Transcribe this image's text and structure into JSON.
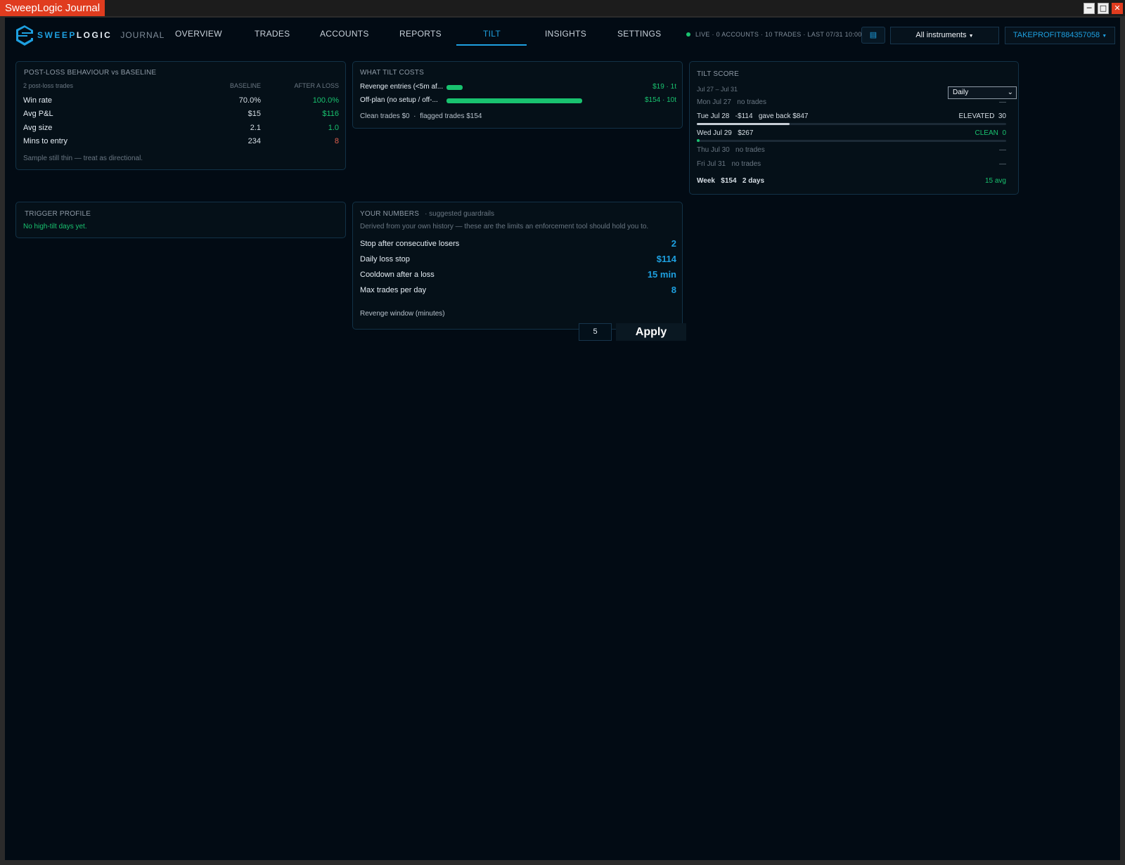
{
  "window": {
    "title": "SweepLogic Journal",
    "buttons": [
      "minimize",
      "maximize",
      "close"
    ]
  },
  "brand": {
    "name_part1": "SWEEP",
    "name_part2": "LOGIC",
    "sub": "JOURNAL",
    "accent": "#1ea0e0"
  },
  "nav": {
    "tabs": [
      {
        "label": "OVERVIEW"
      },
      {
        "label": "TRADES"
      },
      {
        "label": "ACCOUNTS"
      },
      {
        "label": "REPORTS"
      },
      {
        "label": "TILT"
      },
      {
        "label": "INSIGHTS"
      },
      {
        "label": "SETTINGS"
      }
    ],
    "active_tab": "TILT",
    "status": "LIVE · 0 ACCOUNTS · 10 TRADES · LAST 07/31 10:00",
    "instrument_filter": "All instruments",
    "account": "TAKEPROFIT884357058"
  },
  "post_loss": {
    "title": "POST-LOSS BEHAVIOUR vs BASELINE",
    "sample_note": "2 post-loss trades",
    "col_baseline": "BASELINE",
    "col_after": "AFTER A LOSS",
    "rows": [
      {
        "label": "Win rate",
        "baseline": "70.0%",
        "after": "100.0%"
      },
      {
        "label": "Avg P&L",
        "baseline": "$15",
        "after": "$116"
      },
      {
        "label": "Avg size",
        "baseline": "2.1",
        "after": "1.0"
      },
      {
        "label": "Mins to entry",
        "baseline": "234",
        "after": "8"
      }
    ],
    "footnote": "Sample still thin — treat as directional."
  },
  "tilt_costs": {
    "title": "WHAT TILT COSTS",
    "rows": [
      {
        "label": "Revenge entries (<5m af...",
        "amount": "$19",
        "count": "1t",
        "share": 0.12
      },
      {
        "label": "Off-plan (no setup / off-...",
        "amount": "$154",
        "count": "10t",
        "share": 1.0
      }
    ],
    "summary_clean": "Clean trades $0",
    "summary_flagged": "flagged trades $154"
  },
  "tilt_score": {
    "title": "TILT SCORE",
    "period_select": "Daily",
    "range": "Jul 27 – Jul 31",
    "days": [
      {
        "date": "Mon Jul 27",
        "pnl": "",
        "note": "no trades",
        "status": "—",
        "score": "",
        "level": 0
      },
      {
        "date": "Tue Jul 28",
        "pnl": "-$114",
        "note": "gave back $847",
        "status": "ELEVATED",
        "score": "30",
        "level": 0.3
      },
      {
        "date": "Wed Jul 29",
        "pnl": "$267",
        "note": "",
        "status": "CLEAN",
        "score": "0",
        "level": 0
      },
      {
        "date": "Thu Jul 30",
        "pnl": "",
        "note": "no trades",
        "status": "—",
        "score": "",
        "level": 0
      },
      {
        "date": "Fri Jul 31",
        "pnl": "",
        "note": "no trades",
        "status": "—",
        "score": "",
        "level": 0
      }
    ],
    "week_label": "Week",
    "week_pnl": "$154",
    "week_days": "2 days",
    "week_avg": "15 avg"
  },
  "trigger_profile": {
    "title": "TRIGGER PROFILE",
    "message": "No high-tilt days yet."
  },
  "your_numbers": {
    "title": "YOUR NUMBERS",
    "subtitle": "· suggested guardrails",
    "description": "Derived from your own history — these are the limits an enforcement tool should hold you to.",
    "rows": [
      {
        "label": "Stop after consecutive losers",
        "value": "2"
      },
      {
        "label": "Daily loss stop",
        "value": "$114"
      },
      {
        "label": "Cooldown after a loss",
        "value": "15 min"
      },
      {
        "label": "Max trades per day",
        "value": "8"
      }
    ],
    "revenge_label": "Revenge window (minutes)",
    "revenge_value": "5",
    "apply_label": "Apply"
  },
  "colors": {
    "green": "#19c26f",
    "red": "#e0604f",
    "blue": "#1ea0e0",
    "bg": "#020b14",
    "titlebar_accent": "#e03c1f"
  }
}
